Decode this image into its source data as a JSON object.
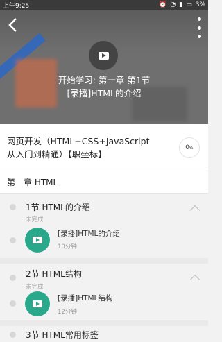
{
  "status_bar": {
    "time": "上午9:25",
    "battery": "3%",
    "icons": [
      "alarm-icon",
      "wifi-icon",
      "signal-icon",
      "battery-icon"
    ]
  },
  "video": {
    "title_line1": "开始学习: 第一章 第1节",
    "title_line2": "[录播]HTML的介绍",
    "icons": [
      "back-icon",
      "more-vertical-icon",
      "play-icon"
    ]
  },
  "course": {
    "title_line1": "网页开发（HTML+CSS+JavaScript",
    "title_line2": "从入门到精通）【职坐标】",
    "progress": "0",
    "progress_unit": "%"
  },
  "chapter": {
    "title": "第一章 HTML"
  },
  "sections": [
    {
      "title": "1节  HTML的介绍",
      "status": "未完成",
      "lessons": [
        {
          "title": "[录播]HTML的介绍",
          "duration": "10分钟"
        }
      ]
    },
    {
      "title": "2节  HTML结构",
      "status": "未完成",
      "lessons": [
        {
          "title": "[录播]HTML结构",
          "duration": "12分钟"
        }
      ]
    },
    {
      "title": "3节  HTML常用标签"
    }
  ],
  "colors": {
    "accent_green": "#2aa88c",
    "status_bar": "#3a3a3a"
  }
}
